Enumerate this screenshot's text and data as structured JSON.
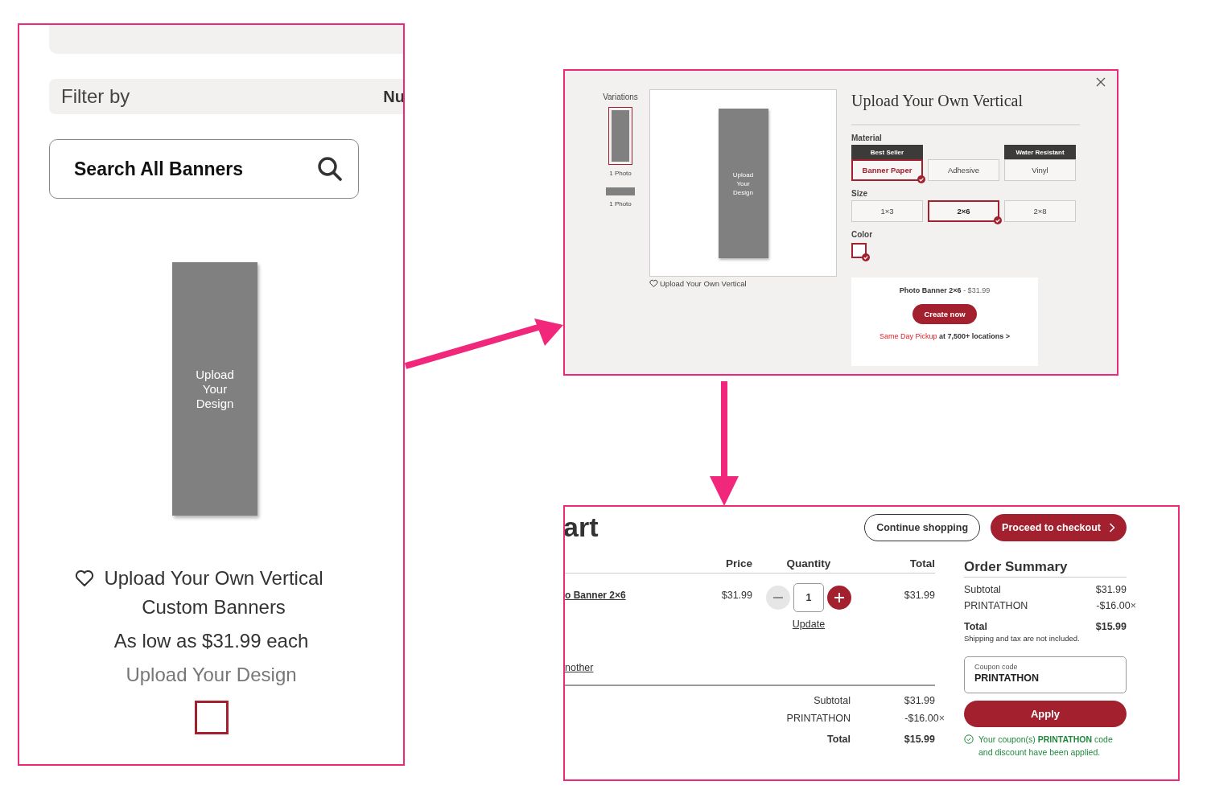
{
  "catalog_panel": {
    "filter_label": "Filter by",
    "filter_cut": "Nu",
    "search": {
      "placeholder": "Search All Banners"
    },
    "product": {
      "thumbnail_text": "Upload Your Design",
      "title": "Upload Your Own Vertical Custom Banners",
      "price": "As low as $31.99 each",
      "cta": "Upload Your Design"
    }
  },
  "product_dialog": {
    "variations_label": "Variations",
    "variations": [
      {
        "caption": "1 Photo",
        "kind": "vertical",
        "selected": true
      },
      {
        "caption": "1 Photo",
        "kind": "horizontal",
        "selected": false
      }
    ],
    "preview_text": "Upload Your Design",
    "caption": "Upload Your Own Vertical",
    "title": "Upload Your Own Vertical",
    "sections": [
      {
        "label": "Material",
        "kind": "buttons",
        "options": [
          {
            "label": "Banner Paper",
            "badge": "Best Seller",
            "selected": true
          },
          {
            "label": "Adhesive",
            "selected": false
          },
          {
            "label": "Vinyl",
            "badge": "Water Resistant",
            "selected": false
          }
        ]
      },
      {
        "label": "Size",
        "kind": "buttons",
        "options": [
          {
            "label": "1×3",
            "selected": false
          },
          {
            "label": "2×6",
            "selected": true
          },
          {
            "label": "2×8",
            "selected": false
          }
        ]
      },
      {
        "label": "Color",
        "kind": "swatches",
        "options": [
          {
            "color": "#ffffff",
            "selected": true
          }
        ]
      }
    ],
    "summary": {
      "line": "**Photo Banner 2×6** - $31.99",
      "button": "Create now",
      "pickup": "Same Day Pickup **at 7,500+ locations >**"
    }
  },
  "cart_panel": {
    "title": "art",
    "buttons": [
      {
        "label": "Continue shopping",
        "kind": "secondary"
      },
      {
        "label": "Proceed to checkout",
        "kind": "primary"
      }
    ],
    "columns": [
      "Price",
      "Quantity",
      "Total"
    ],
    "items": [
      {
        "name": "o Banner 2×6",
        "price": "$31.99",
        "quantity": "1",
        "update": "Update",
        "total": "$31.99"
      }
    ],
    "extra_link": "nother",
    "totals": [
      {
        "label": "Subtotal",
        "value": "$31.99",
        "kind": "plain"
      },
      {
        "label": "PRINTATHON",
        "value": "-$16.00",
        "remove": "×",
        "kind": "discount"
      },
      {
        "label": "Total",
        "value": "$15.99",
        "kind": "total"
      }
    ],
    "order_summary": {
      "title": "Order Summary",
      "lines": [
        {
          "label": "Subtotal",
          "value": "$31.99",
          "kind": "plain"
        },
        {
          "label": "PRINTATHON",
          "value": "-$16.00",
          "remove": "×",
          "kind": "discount"
        },
        {
          "label": "Total",
          "value": "$15.99",
          "kind": "total"
        }
      ],
      "note": "Shipping and tax are not included.",
      "coupon": {
        "label": "Coupon code",
        "value": "PRINTATHON"
      },
      "apply": "Apply",
      "message": "Your coupon(s) **PRINTATHON** code and discount have been applied."
    }
  }
}
